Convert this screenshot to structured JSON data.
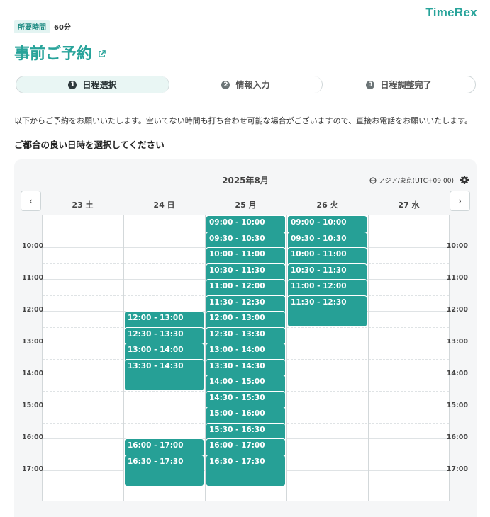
{
  "brand": {
    "logo_text": "TimeRex"
  },
  "duration": {
    "label": "所要時間",
    "value": "60分"
  },
  "page": {
    "title": "事前ご予約"
  },
  "steps": [
    {
      "number": "1",
      "label": "日程選択"
    },
    {
      "number": "2",
      "label": "情報入力"
    },
    {
      "number": "3",
      "label": "日程調整完了"
    }
  ],
  "intro_text": "以下からご予約をお願いいたします。空いてない時間も打ち合わせ可能な場合がございますので、直接お電話をお願いいたします。",
  "subheading": "ご都合の良い日時を選択してください",
  "calendar": {
    "month": "2025年8月",
    "timezone": "アジア/東京(UTC+09:00)",
    "prev_label": "‹",
    "next_label": "›",
    "days": [
      "23 土",
      "24 日",
      "25 月",
      "26 火",
      "27 水"
    ],
    "time_labels": [
      "10:00",
      "11:00",
      "12:00",
      "13:00",
      "14:00",
      "15:00",
      "16:00",
      "17:00"
    ],
    "columns": [
      {
        "day": "23 土",
        "slots": []
      },
      {
        "day": "24 日",
        "slots": [
          "12:00 - 13:00",
          "12:30 - 13:30",
          "13:00 - 14:00",
          "13:30 - 14:30",
          "16:00 - 17:00",
          "16:30 - 17:30"
        ]
      },
      {
        "day": "25 月",
        "slots": [
          "09:00 - 10:00",
          "09:30 - 10:30",
          "10:00 - 11:00",
          "10:30 - 11:30",
          "11:00 - 12:00",
          "11:30 - 12:30",
          "12:00 - 13:00",
          "12:30 - 13:30",
          "13:00 - 14:00",
          "13:30 - 14:30",
          "14:00 - 15:00",
          "14:30 - 15:30",
          "15:00 - 16:00",
          "15:30 - 16:30",
          "16:00 - 17:00",
          "16:30 - 17:30"
        ]
      },
      {
        "day": "26 火",
        "slots": [
          "09:00 - 10:00",
          "09:30 - 10:30",
          "10:00 - 11:00",
          "10:30 - 11:30",
          "11:00 - 12:00",
          "11:30 - 12:30"
        ]
      },
      {
        "day": "27 水",
        "slots": []
      }
    ]
  },
  "colors": {
    "accent": "#27a39a",
    "slot": "#26a096",
    "active_step_bg": "#e9f6f4"
  }
}
